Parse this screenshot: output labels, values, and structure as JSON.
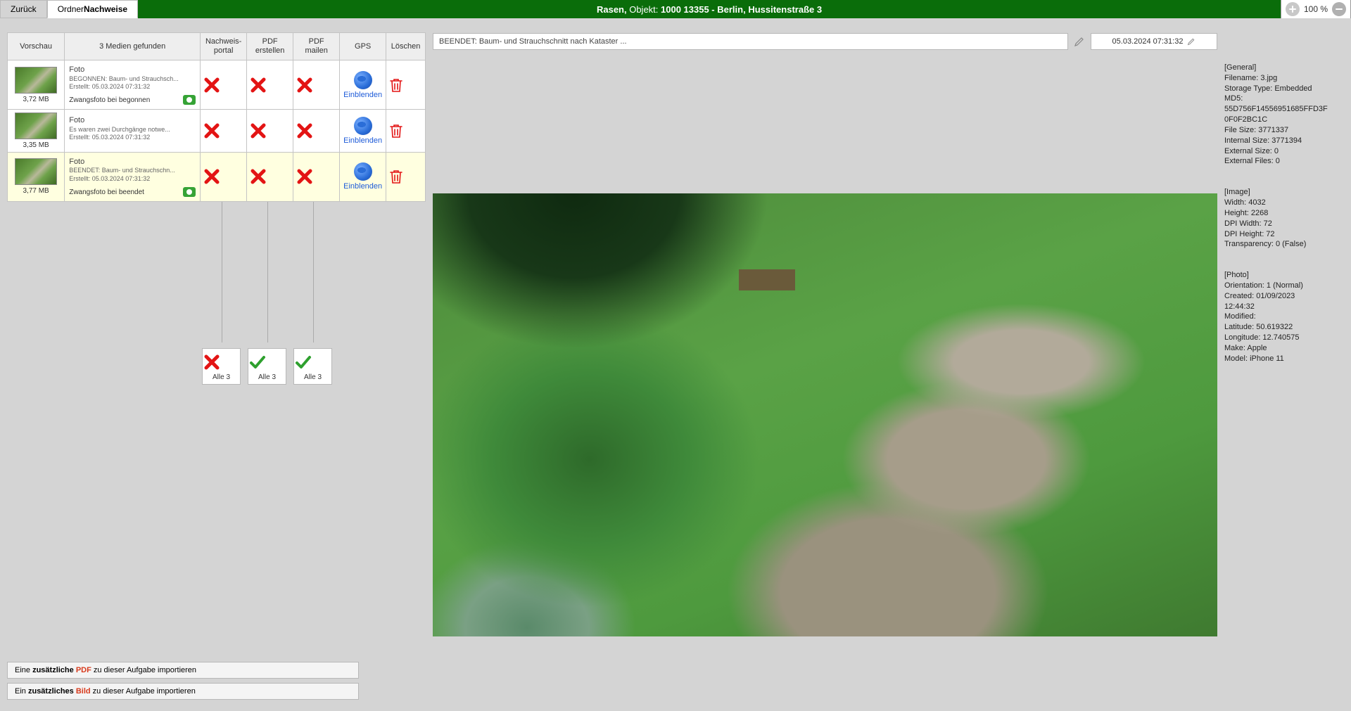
{
  "tabs": {
    "back": "Zurück",
    "folder_prefix": "Ordner ",
    "folder_bold": "Nachweise"
  },
  "title": {
    "pre": "Rasen, ",
    "mid": "Objekt: ",
    "bold": "1000   13355 - Berlin, Hussitenstraße 3"
  },
  "zoom": {
    "value": "100 %"
  },
  "grid": {
    "headers": {
      "thumb": "Vorschau",
      "desc": "3 Medien gefunden",
      "portal_l1": "Nachweis-",
      "portal_l2": "portal",
      "pdfc_l1": "PDF",
      "pdfc_l2": "erstellen",
      "pdfm_l1": "PDF",
      "pdfm_l2": "mailen",
      "gps": "GPS",
      "del": "Löschen"
    },
    "gps_label": "Einblenden",
    "rows": [
      {
        "size": "3,72 MB",
        "title": "Foto",
        "l2": "BEGONNEN: Baum- und Strauchsch...",
        "l3": "Erstellt: 05.03.2024 07:31:32",
        "note": "Zwangsfoto bei begonnen",
        "cam": true
      },
      {
        "size": "3,35 MB",
        "title": "Foto",
        "l2": "Es waren zwei Durchgänge notwe...",
        "l3": "Erstellt: 05.03.2024 07:31:32",
        "note": "",
        "cam": false
      },
      {
        "size": "3,77 MB",
        "title": "Foto",
        "l2": "BEENDET: Baum- und Strauchschn...",
        "l3": "Erstellt: 05.03.2024 07:31:32",
        "note": "Zwangsfoto bei beendet",
        "cam": true
      }
    ],
    "batch": [
      {
        "kind": "x",
        "label": "Alle 3"
      },
      {
        "kind": "check",
        "label": "Alle 3"
      },
      {
        "kind": "check",
        "label": "Alle 3"
      }
    ]
  },
  "import": {
    "pdf_pre": "Eine ",
    "pdf_bold": "zusätzliche ",
    "pdf_red": "PDF",
    "pdf_post": " zu dieser Aufgabe importieren",
    "img_pre": "Ein ",
    "img_bold": "zusätzliches ",
    "img_red": "Bild",
    "img_post": " zu dieser Aufgabe importieren"
  },
  "preview": {
    "caption": "BEENDET: Baum- und Strauchschnitt nach Kataster ...",
    "date": "05.03.2024 07:31:32"
  },
  "meta": {
    "general": "[General]\nFilename: 3.jpg\nStorage Type: Embedded\nMD5:\n55D756F14556951685FFD3F\n0F0F2BC1C\nFile Size: 3771337\nInternal Size: 3771394\nExternal Size: 0\nExternal Files: 0",
    "image": "[Image]\nWidth: 4032\nHeight: 2268\nDPI Width: 72\nDPI Height: 72\nTransparency: 0 (False)",
    "photo": "[Photo]\nOrientation: 1 (Normal)\nCreated: 01/09/2023\n12:44:32\nModified:\nLatitude: 50.619322\nLongitude: 12.740575\nMake: Apple\nModel: iPhone 11"
  }
}
